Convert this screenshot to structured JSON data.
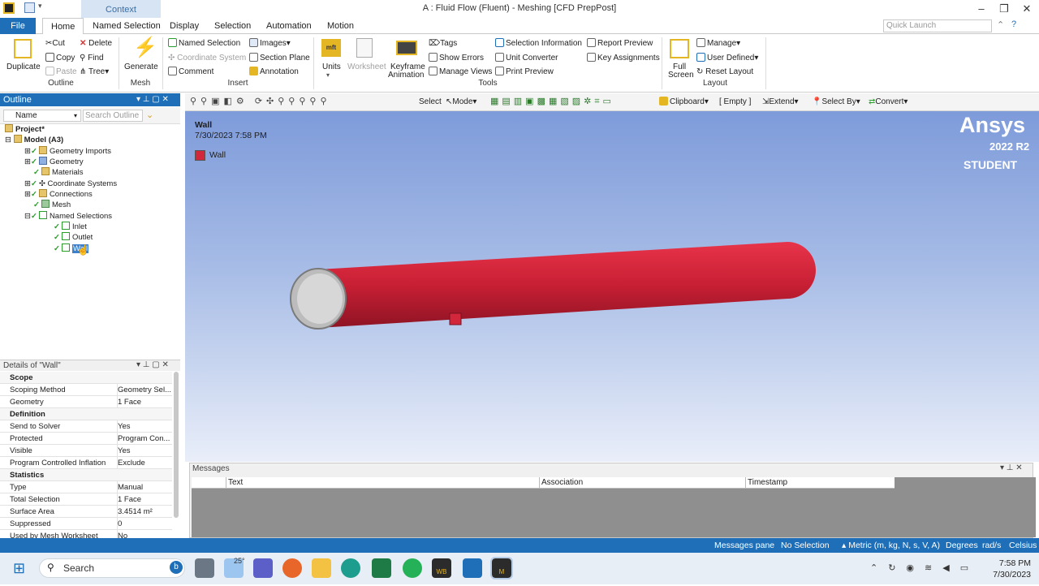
{
  "window": {
    "title": "A : Fluid Flow (Fluent) - Meshing [CFD PrepPost]",
    "context_band": "Context",
    "quick_launch_placeholder": "Quick Launch"
  },
  "tabs": [
    "File",
    "Home",
    "Named Selection",
    "Display",
    "Selection",
    "Automation",
    "Motion"
  ],
  "ribbon": {
    "outline": {
      "duplicate": "Duplicate",
      "cut": "Cut",
      "copy": "Copy",
      "paste": "Paste",
      "delete": "Delete",
      "find": "Find",
      "tree": "Tree",
      "label": "Outline"
    },
    "mesh": {
      "generate": "Generate",
      "label": "Mesh"
    },
    "insert": {
      "named_selection": "Named Selection",
      "coordinate_system": "Coordinate System",
      "comment": "Comment",
      "images": "Images",
      "section_plane": "Section Plane",
      "annotation": "Annotation",
      "label": "Insert"
    },
    "tools": {
      "units": "Units",
      "worksheet": "Worksheet",
      "keyframe": "Keyframe",
      "animation": "Animation",
      "tags": "Tags",
      "show_errors": "Show Errors",
      "manage_views": "Manage Views",
      "selection_information": "Selection Information",
      "unit_converter": "Unit Converter",
      "print_preview": "Print Preview",
      "report_preview": "Report Preview",
      "key_assignments": "Key Assignments",
      "label": "Tools"
    },
    "layout": {
      "full": "Full",
      "screen": "Screen",
      "manage": "Manage",
      "user_defined": "User Defined",
      "reset_layout": "Reset Layout",
      "label": "Layout"
    }
  },
  "outline": {
    "title": "Outline",
    "name_col": "Name",
    "search_placeholder": "Search Outline",
    "items": {
      "project": "Project*",
      "model": "Model (A3)",
      "geometry_imports": "Geometry Imports",
      "geometry": "Geometry",
      "materials": "Materials",
      "coordinate_systems": "Coordinate Systems",
      "connections": "Connections",
      "mesh": "Mesh",
      "named_selections": "Named Selections",
      "inlet": "Inlet",
      "outlet": "Outlet",
      "wall": "Wall"
    }
  },
  "details": {
    "title": "Details of \"Wall\"",
    "rows": [
      {
        "k": "Scope",
        "v": "",
        "section": true
      },
      {
        "k": "Scoping Method",
        "v": "Geometry Sel..."
      },
      {
        "k": "Geometry",
        "v": "1 Face"
      },
      {
        "k": "Definition",
        "v": "",
        "section": true
      },
      {
        "k": "Send to Solver",
        "v": "Yes"
      },
      {
        "k": "Protected",
        "v": "Program Con..."
      },
      {
        "k": "Visible",
        "v": "Yes"
      },
      {
        "k": "Program Controlled Inflation",
        "v": "Exclude"
      },
      {
        "k": "Statistics",
        "v": "",
        "section": true
      },
      {
        "k": "Type",
        "v": "Manual"
      },
      {
        "k": "Total Selection",
        "v": "1 Face"
      },
      {
        "k": "Surface Area",
        "v": "3.4514 m²"
      },
      {
        "k": "Suppressed",
        "v": "0"
      },
      {
        "k": "Used by Mesh Worksheet",
        "v": "No"
      }
    ]
  },
  "view_toolbar": {
    "select": "Select",
    "mode": "Mode",
    "clipboard": "Clipboard",
    "empty": "[ Empty ]",
    "extend": "Extend",
    "select_by": "Select By",
    "convert": "Convert"
  },
  "viewport": {
    "title": "Wall",
    "datetime": "7/30/2023 7:58 PM",
    "legend_label": "Wall",
    "brand": "Ansys",
    "version": "2022 R2",
    "edition": "STUDENT",
    "pipe_color": "#d2263a"
  },
  "messages": {
    "title": "Messages",
    "col_text": "Text",
    "col_association": "Association",
    "col_timestamp": "Timestamp"
  },
  "status": {
    "messages_pane": "Messages pane",
    "selection": "No Selection",
    "units": "Metric (m, kg, N, s, V, A)",
    "degrees": "Degrees",
    "rads": "rad/s",
    "temp": "Celsius"
  },
  "taskbar": {
    "search": "Search",
    "weather": "25°",
    "time": "7:58 PM",
    "date": "7/30/2023",
    "wb": "WB",
    "m": "M"
  }
}
